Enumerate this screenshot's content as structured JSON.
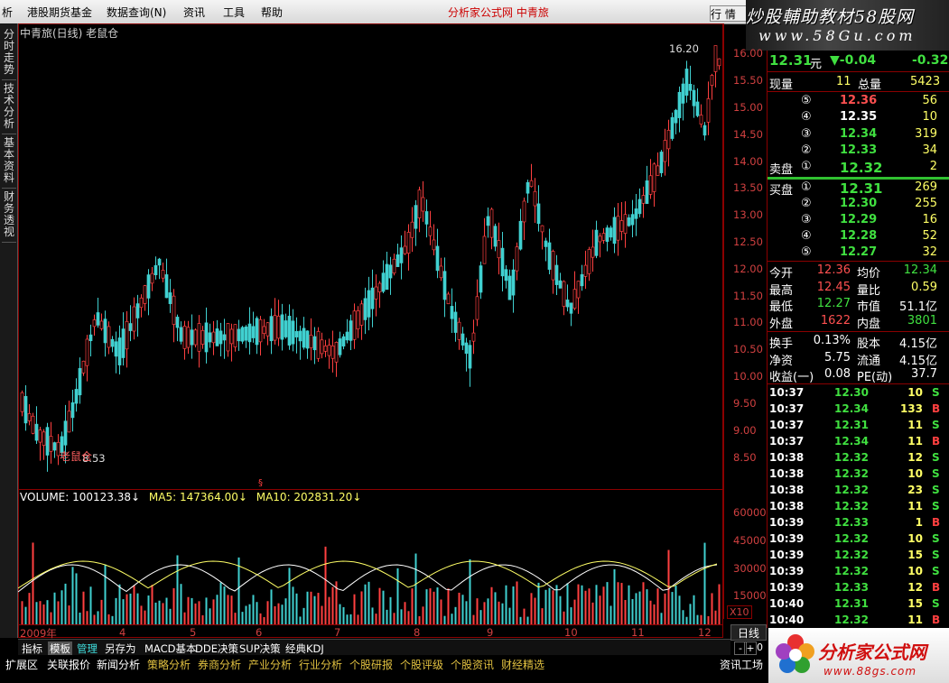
{
  "menubar": {
    "items": [
      "析",
      "港股期货基金",
      "数据查询(N)",
      "资讯",
      "工具",
      "帮助"
    ],
    "center_title": "分析家公式网  中青旅",
    "hang_button": "行 情",
    "watermark": "炒股輔助教材58股网",
    "watermark_url": "www.58Gu.com"
  },
  "left_tabs": [
    "分时走势",
    "技术分析",
    "基本资料",
    "财务透视"
  ],
  "chart": {
    "title": "中青旅(日线) 老鼠仓",
    "peak_label": "16.20",
    "low_label": "8.53",
    "indicator_label": "老鼠仓",
    "price_axis": [
      "16.00",
      "15.50",
      "15.00",
      "14.50",
      "14.00",
      "13.50",
      "13.00",
      "12.50",
      "12.00",
      "11.50",
      "11.00",
      "10.50",
      "10.00",
      "9.50",
      "9.00",
      "8.50"
    ],
    "volume_axis": [
      "60000",
      "45000",
      "30000",
      "15000"
    ],
    "volume_unit": "X10",
    "volume_header": {
      "volume": "VOLUME: 100123.38",
      "ma5": "MA5: 147364.00",
      "ma10": "MA10: 202831.20"
    },
    "x_labels": [
      "2009年",
      "4",
      "5",
      "6",
      "7",
      "8",
      "9",
      "10",
      "11",
      "12"
    ],
    "period_label": "日线",
    "colors": {
      "up": "#ff4040",
      "down": "#40d0d0",
      "ma_white": "#ffffff",
      "ma_yellow": "#ffff66",
      "axis": "#8b0000",
      "axis_text": "#d04040"
    }
  },
  "tabbar": {
    "tabs": [
      "指标",
      "模板",
      "管理",
      "另存为",
      "MACD基本",
      "DDE决策",
      "SUP决策",
      "经典KDJ"
    ],
    "active": "模板",
    "zoom_minus": "-",
    "zoom_plus": "+",
    "zoom_value": "0"
  },
  "funcbar": {
    "items": [
      "扩展区",
      "关联报价",
      "新闻分析",
      "策略分析",
      "券商分析",
      "产业分析",
      "行业分析",
      "个股研报",
      "个股评级",
      "个股资讯",
      "财经精选"
    ],
    "right": "资讯工场"
  },
  "logo": {
    "text": "分析家公式网",
    "url": "www.88gs.com"
  },
  "quote": {
    "price": "12.31",
    "unit": "元",
    "change": "▼-0.04",
    "change_pct": "-0.32",
    "now_vol_label": "现量",
    "now_vol": "11",
    "total_vol_label": "总量",
    "total_vol": "5423",
    "asks": [
      {
        "level": "⑤",
        "price": "12.36",
        "vol": "56",
        "color": "#ff5050"
      },
      {
        "level": "④",
        "price": "12.35",
        "vol": "10",
        "color": "#ffffff"
      },
      {
        "level": "③",
        "price": "12.34",
        "vol": "319",
        "color": "#40e040"
      },
      {
        "level": "②",
        "price": "12.33",
        "vol": "34",
        "color": "#40e040"
      },
      {
        "level": "①",
        "price": "12.32",
        "vol": "2",
        "color": "#40e040"
      }
    ],
    "ask_label": "卖盘",
    "bid_label": "买盘",
    "bids": [
      {
        "level": "①",
        "price": "12.31",
        "vol": "269",
        "color": "#40e040"
      },
      {
        "level": "②",
        "price": "12.30",
        "vol": "255",
        "color": "#40e040"
      },
      {
        "level": "③",
        "price": "12.29",
        "vol": "16",
        "color": "#40e040"
      },
      {
        "level": "④",
        "price": "12.28",
        "vol": "52",
        "color": "#40e040"
      },
      {
        "level": "⑤",
        "price": "12.27",
        "vol": "32",
        "color": "#40e040"
      }
    ],
    "stats": [
      {
        "l1": "今开",
        "v1": "12.36",
        "c1": "#ff5050",
        "l2": "均价",
        "v2": "12.34",
        "c2": "#40e040"
      },
      {
        "l1": "最高",
        "v1": "12.45",
        "c1": "#ff5050",
        "l2": "量比",
        "v2": "0.59",
        "c2": "#ffff66"
      },
      {
        "l1": "最低",
        "v1": "12.27",
        "c1": "#40e040",
        "l2": "市值",
        "v2": "51.1亿",
        "c2": "#ffffff"
      },
      {
        "l1": "外盘",
        "v1": "1622",
        "c1": "#ff5050",
        "l2": "内盘",
        "v2": "3801",
        "c2": "#40e040"
      }
    ],
    "stats2": [
      {
        "l1": "换手",
        "v1": "0.13%",
        "l2": "股本",
        "v2": "4.15亿"
      },
      {
        "l1": "净资",
        "v1": "5.75",
        "l2": "流通",
        "v2": "4.15亿"
      },
      {
        "l1": "收益(一)",
        "v1": "0.08",
        "l2": "PE(动)",
        "v2": "37.7"
      }
    ],
    "ticks": [
      {
        "t": "10:37",
        "p": "12.30",
        "v": "10",
        "d": "S"
      },
      {
        "t": "10:37",
        "p": "12.34",
        "v": "133",
        "d": "B"
      },
      {
        "t": "10:37",
        "p": "12.31",
        "v": "11",
        "d": "S"
      },
      {
        "t": "10:37",
        "p": "12.34",
        "v": "11",
        "d": "B"
      },
      {
        "t": "10:38",
        "p": "12.32",
        "v": "12",
        "d": "S"
      },
      {
        "t": "10:38",
        "p": "12.32",
        "v": "10",
        "d": "S"
      },
      {
        "t": "10:38",
        "p": "12.32",
        "v": "23",
        "d": "S"
      },
      {
        "t": "10:38",
        "p": "12.32",
        "v": "11",
        "d": "S"
      },
      {
        "t": "10:39",
        "p": "12.33",
        "v": "1",
        "d": "B"
      },
      {
        "t": "10:39",
        "p": "12.32",
        "v": "10",
        "d": "S"
      },
      {
        "t": "10:39",
        "p": "12.32",
        "v": "15",
        "d": "S"
      },
      {
        "t": "10:39",
        "p": "12.32",
        "v": "10",
        "d": "S"
      },
      {
        "t": "10:39",
        "p": "12.33",
        "v": "12",
        "d": "B"
      },
      {
        "t": "10:40",
        "p": "12.31",
        "v": "15",
        "d": "S"
      },
      {
        "t": "10:40",
        "p": "12.32",
        "v": "11",
        "d": "B"
      }
    ]
  }
}
